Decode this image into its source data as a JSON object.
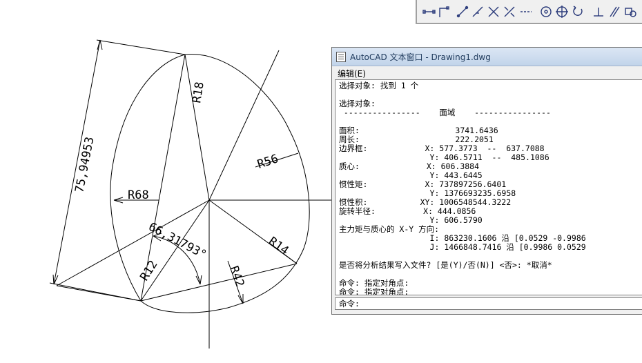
{
  "drawing": {
    "dimensions": {
      "overall_length": "75,94953",
      "radius_r18": "R18",
      "radius_r56": "R56",
      "radius_r68": "R68",
      "radius_r12": "R12",
      "radius_r14": "R14",
      "radius_r42": "R42",
      "angle": "66,31793°"
    }
  },
  "toolbar": {
    "icons": [
      "dim-linear-icon",
      "dim-ordinate-icon",
      "dim-aligned-icon",
      "dim-arc-icon",
      "dim-intersect-icon",
      "dim-break-icon",
      "dim-dashed-icon",
      "dim-center-icon",
      "dim-crosshair-icon",
      "dim-rotate-icon",
      "dim-perpendicular-icon",
      "dim-parallel-icon",
      "dim-edit-icon"
    ]
  },
  "text_window": {
    "title": "AutoCAD 文本窗口 - Drawing1.dwg",
    "menu_edit": "编辑(E)",
    "lines": [
      "选择对象: 找到 1 个",
      "",
      "选择对象:",
      " ----------------    面域    ----------------",
      "",
      "面积:                    3741.6436",
      "周长:                    222.2051",
      "边界框:            X: 577.3773  --  637.7088",
      "                   Y: 406.5711  --  485.1086",
      "质心:              X: 606.3884",
      "                   Y: 443.6445",
      "惯性矩:            X: 737897256.6401",
      "                   Y: 1376693235.6958",
      "惯性积:           XY: 1006548544.3222",
      "旋转半径:          X: 444.0856",
      "                   Y: 606.5790",
      "主力矩与质心的 X-Y 方向:",
      "                   I: 863230.1606 沿 [0.0529 -0.9986",
      "                   J: 1466848.7416 沿 [0.9986 0.0529",
      "",
      "是否将分析结果写入文件? [是(Y)/否(N)] <否>: *取消*",
      "",
      "命令: 指定对角点:",
      "命令: 指定对角点:"
    ],
    "command_prompt": "命令:"
  }
}
